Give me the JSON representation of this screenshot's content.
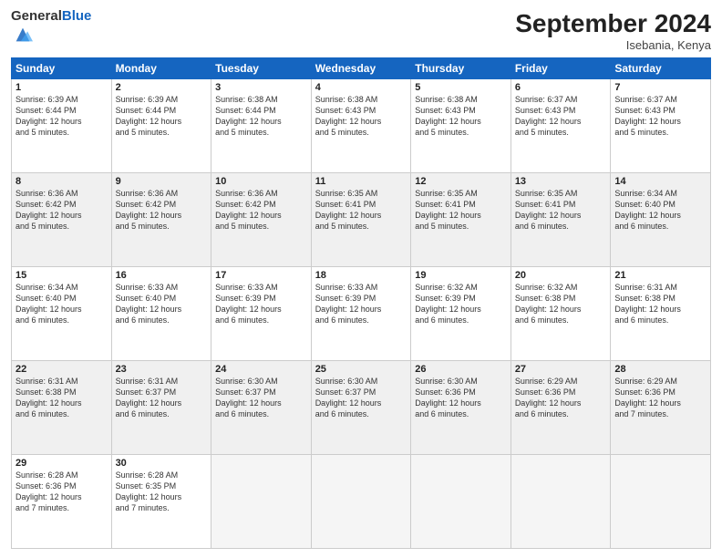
{
  "logo": {
    "general": "General",
    "blue": "Blue"
  },
  "header": {
    "month": "September 2024",
    "location": "Isebania, Kenya"
  },
  "days": [
    "Sunday",
    "Monday",
    "Tuesday",
    "Wednesday",
    "Thursday",
    "Friday",
    "Saturday"
  ],
  "weeks": [
    [
      {
        "num": "1",
        "lines": [
          "Sunrise: 6:39 AM",
          "Sunset: 6:44 PM",
          "Daylight: 12 hours",
          "and 5 minutes."
        ]
      },
      {
        "num": "2",
        "lines": [
          "Sunrise: 6:39 AM",
          "Sunset: 6:44 PM",
          "Daylight: 12 hours",
          "and 5 minutes."
        ]
      },
      {
        "num": "3",
        "lines": [
          "Sunrise: 6:38 AM",
          "Sunset: 6:44 PM",
          "Daylight: 12 hours",
          "and 5 minutes."
        ]
      },
      {
        "num": "4",
        "lines": [
          "Sunrise: 6:38 AM",
          "Sunset: 6:43 PM",
          "Daylight: 12 hours",
          "and 5 minutes."
        ]
      },
      {
        "num": "5",
        "lines": [
          "Sunrise: 6:38 AM",
          "Sunset: 6:43 PM",
          "Daylight: 12 hours",
          "and 5 minutes."
        ]
      },
      {
        "num": "6",
        "lines": [
          "Sunrise: 6:37 AM",
          "Sunset: 6:43 PM",
          "Daylight: 12 hours",
          "and 5 minutes."
        ]
      },
      {
        "num": "7",
        "lines": [
          "Sunrise: 6:37 AM",
          "Sunset: 6:43 PM",
          "Daylight: 12 hours",
          "and 5 minutes."
        ]
      }
    ],
    [
      {
        "num": "8",
        "lines": [
          "Sunrise: 6:36 AM",
          "Sunset: 6:42 PM",
          "Daylight: 12 hours",
          "and 5 minutes."
        ]
      },
      {
        "num": "9",
        "lines": [
          "Sunrise: 6:36 AM",
          "Sunset: 6:42 PM",
          "Daylight: 12 hours",
          "and 5 minutes."
        ]
      },
      {
        "num": "10",
        "lines": [
          "Sunrise: 6:36 AM",
          "Sunset: 6:42 PM",
          "Daylight: 12 hours",
          "and 5 minutes."
        ]
      },
      {
        "num": "11",
        "lines": [
          "Sunrise: 6:35 AM",
          "Sunset: 6:41 PM",
          "Daylight: 12 hours",
          "and 5 minutes."
        ]
      },
      {
        "num": "12",
        "lines": [
          "Sunrise: 6:35 AM",
          "Sunset: 6:41 PM",
          "Daylight: 12 hours",
          "and 5 minutes."
        ]
      },
      {
        "num": "13",
        "lines": [
          "Sunrise: 6:35 AM",
          "Sunset: 6:41 PM",
          "Daylight: 12 hours",
          "and 6 minutes."
        ]
      },
      {
        "num": "14",
        "lines": [
          "Sunrise: 6:34 AM",
          "Sunset: 6:40 PM",
          "Daylight: 12 hours",
          "and 6 minutes."
        ]
      }
    ],
    [
      {
        "num": "15",
        "lines": [
          "Sunrise: 6:34 AM",
          "Sunset: 6:40 PM",
          "Daylight: 12 hours",
          "and 6 minutes."
        ]
      },
      {
        "num": "16",
        "lines": [
          "Sunrise: 6:33 AM",
          "Sunset: 6:40 PM",
          "Daylight: 12 hours",
          "and 6 minutes."
        ]
      },
      {
        "num": "17",
        "lines": [
          "Sunrise: 6:33 AM",
          "Sunset: 6:39 PM",
          "Daylight: 12 hours",
          "and 6 minutes."
        ]
      },
      {
        "num": "18",
        "lines": [
          "Sunrise: 6:33 AM",
          "Sunset: 6:39 PM",
          "Daylight: 12 hours",
          "and 6 minutes."
        ]
      },
      {
        "num": "19",
        "lines": [
          "Sunrise: 6:32 AM",
          "Sunset: 6:39 PM",
          "Daylight: 12 hours",
          "and 6 minutes."
        ]
      },
      {
        "num": "20",
        "lines": [
          "Sunrise: 6:32 AM",
          "Sunset: 6:38 PM",
          "Daylight: 12 hours",
          "and 6 minutes."
        ]
      },
      {
        "num": "21",
        "lines": [
          "Sunrise: 6:31 AM",
          "Sunset: 6:38 PM",
          "Daylight: 12 hours",
          "and 6 minutes."
        ]
      }
    ],
    [
      {
        "num": "22",
        "lines": [
          "Sunrise: 6:31 AM",
          "Sunset: 6:38 PM",
          "Daylight: 12 hours",
          "and 6 minutes."
        ]
      },
      {
        "num": "23",
        "lines": [
          "Sunrise: 6:31 AM",
          "Sunset: 6:37 PM",
          "Daylight: 12 hours",
          "and 6 minutes."
        ]
      },
      {
        "num": "24",
        "lines": [
          "Sunrise: 6:30 AM",
          "Sunset: 6:37 PM",
          "Daylight: 12 hours",
          "and 6 minutes."
        ]
      },
      {
        "num": "25",
        "lines": [
          "Sunrise: 6:30 AM",
          "Sunset: 6:37 PM",
          "Daylight: 12 hours",
          "and 6 minutes."
        ]
      },
      {
        "num": "26",
        "lines": [
          "Sunrise: 6:30 AM",
          "Sunset: 6:36 PM",
          "Daylight: 12 hours",
          "and 6 minutes."
        ]
      },
      {
        "num": "27",
        "lines": [
          "Sunrise: 6:29 AM",
          "Sunset: 6:36 PM",
          "Daylight: 12 hours",
          "and 6 minutes."
        ]
      },
      {
        "num": "28",
        "lines": [
          "Sunrise: 6:29 AM",
          "Sunset: 6:36 PM",
          "Daylight: 12 hours",
          "and 7 minutes."
        ]
      }
    ],
    [
      {
        "num": "29",
        "lines": [
          "Sunrise: 6:28 AM",
          "Sunset: 6:36 PM",
          "Daylight: 12 hours",
          "and 7 minutes."
        ]
      },
      {
        "num": "30",
        "lines": [
          "Sunrise: 6:28 AM",
          "Sunset: 6:35 PM",
          "Daylight: 12 hours",
          "and 7 minutes."
        ]
      },
      {
        "num": "",
        "lines": []
      },
      {
        "num": "",
        "lines": []
      },
      {
        "num": "",
        "lines": []
      },
      {
        "num": "",
        "lines": []
      },
      {
        "num": "",
        "lines": []
      }
    ]
  ]
}
